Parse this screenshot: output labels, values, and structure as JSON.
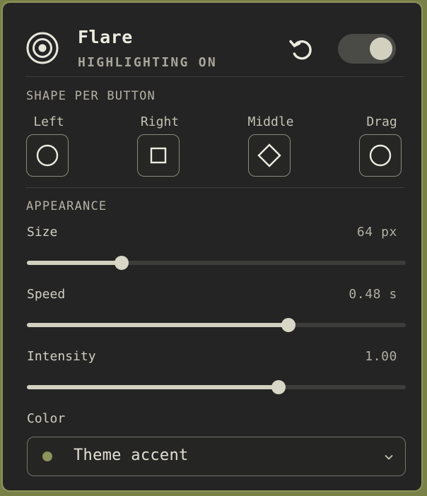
{
  "header": {
    "app_name": "Flare",
    "status": "HIGHLIGHTING ON",
    "logo_icon": "concentric-target-icon",
    "reset_icon": "reset-rotate-icon",
    "enabled": true
  },
  "shape_section": {
    "title": "SHAPE PER BUTTON",
    "buttons": [
      {
        "label": "Left",
        "shape": "circle"
      },
      {
        "label": "Right",
        "shape": "square"
      },
      {
        "label": "Middle",
        "shape": "diamond"
      },
      {
        "label": "Drag",
        "shape": "circle"
      }
    ]
  },
  "appearance": {
    "title": "APPEARANCE",
    "sliders": [
      {
        "label": "Size",
        "value_text": "64 px",
        "level": 0.25
      },
      {
        "label": "Speed",
        "value_text": "0.48 s",
        "level": 0.69
      },
      {
        "label": "Intensity",
        "value_text": "1.00",
        "level": 0.665
      }
    ],
    "color_label": "Color",
    "color_value": "Theme accent",
    "color_dot": "#8d935a",
    "chevron_icon": "chevron-down-icon"
  },
  "colors": {
    "accent": "#8d935a",
    "panel_bg": "#242424",
    "slider_fill": "#d2d0bf"
  }
}
